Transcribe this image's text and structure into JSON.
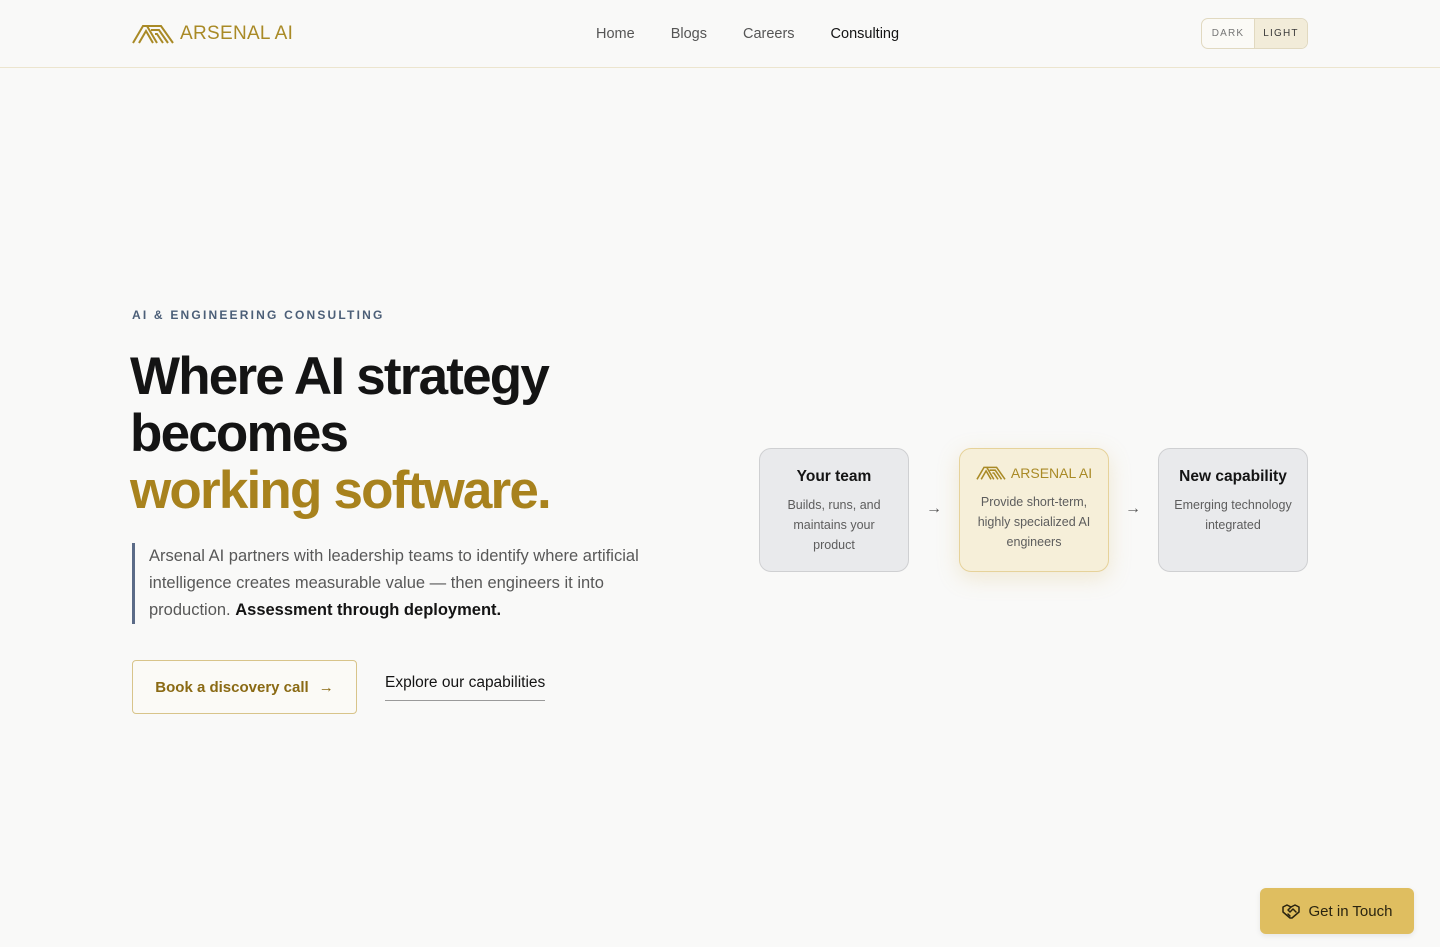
{
  "brand": {
    "name": "ARSENAL AI",
    "color": "#a98a26",
    "icon": "arsenal-logo-icon"
  },
  "nav": {
    "items": [
      {
        "label": "Home",
        "active": false
      },
      {
        "label": "Blogs",
        "active": false
      },
      {
        "label": "Careers",
        "active": false
      },
      {
        "label": "Consulting",
        "active": true
      }
    ]
  },
  "theme_toggle": {
    "dark_label": "DARK",
    "light_label": "LIGHT",
    "selected": "LIGHT"
  },
  "hero": {
    "eyebrow": "AI & ENGINEERING CONSULTING",
    "headline_line1": "Where AI strategy",
    "headline_line2": "becomes",
    "headline_accent": "working software.",
    "lede_text": "Arsenal AI partners with leadership teams to identify where artificial intelligence creates measurable value — then engineers it into production.",
    "lede_strong": "Assessment through deployment.",
    "primary_cta": "Book a discovery call",
    "secondary_cta": "Explore our capabilities"
  },
  "flow": {
    "cards": [
      {
        "title": "Your team",
        "desc": "Builds, runs, and maintains your product"
      },
      {
        "title": "ARSENAL AI",
        "desc": "Provide short-term, highly specialized AI engineers"
      },
      {
        "title": "New capability",
        "desc": "Emerging technology integrated"
      }
    ],
    "arrow_icon": "arrow-right-icon"
  },
  "fab": {
    "label": "Get in Touch",
    "icon": "handshake-icon"
  },
  "colors": {
    "accent": "#a8821d",
    "fab_bg": "#dfbe60",
    "highlight_card_bg": "#f6efd9",
    "card_bg": "#e9eaec",
    "lede_border": "#5b6b87"
  }
}
